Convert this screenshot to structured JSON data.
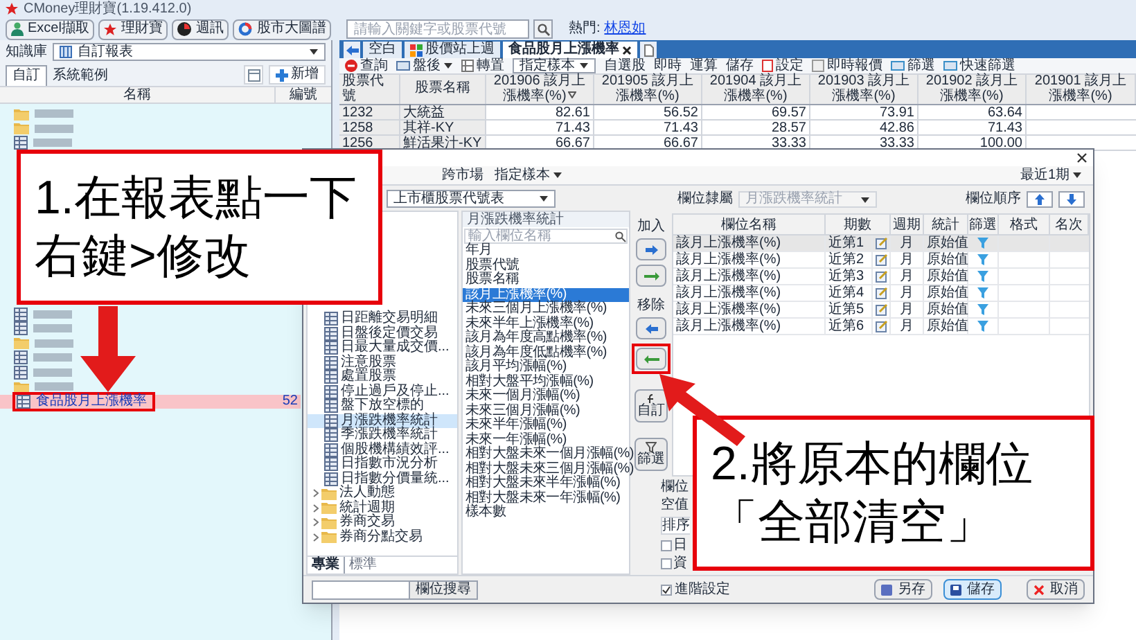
{
  "window": {
    "title": "CMoney理財寶(1.19.412.0)"
  },
  "main_toolbar": {
    "buttons": [
      "Excel擷取",
      "理財寶",
      "週訊",
      "股市大圖譜"
    ],
    "search": {
      "placeholder": "請輸入關鍵字或股票代號"
    },
    "hot_label": "熱門:",
    "hot_link": "林恩如"
  },
  "sidebar": {
    "library_label": "知識庫",
    "library_value": "自訂報表",
    "tabs": [
      {
        "label": "自訂",
        "selected": true
      },
      {
        "label": "系統範例",
        "selected": false
      }
    ],
    "add_button": "新增",
    "columns": [
      "名稱",
      "編號"
    ],
    "items_top": [
      {
        "kind": "folder",
        "selected": false
      },
      {
        "kind": "folder",
        "selected": false
      },
      {
        "kind": "report",
        "selected": false
      }
    ],
    "items_bottom": [
      {
        "kind": "report",
        "selected": false
      },
      {
        "kind": "report",
        "selected": false
      },
      {
        "kind": "folder",
        "selected": false
      },
      {
        "kind": "report",
        "selected": false
      },
      {
        "kind": "report",
        "selected": false
      },
      {
        "kind": "folder",
        "selected": false
      },
      {
        "kind": "report",
        "label": "食品股月上漲機率",
        "number": "52",
        "selected": true
      }
    ]
  },
  "report_tabs": [
    {
      "label": "空白",
      "selected": false
    },
    {
      "label": "股價站上週",
      "selected": false
    },
    {
      "label": "食品股月上漲機率",
      "selected": true
    }
  ],
  "report_toolbar": [
    {
      "kind": "icon",
      "label": "查詢"
    },
    {
      "kind": "menu",
      "label": "盤後"
    },
    {
      "kind": "icon",
      "label": "轉置"
    },
    {
      "kind": "select",
      "label": "指定樣本"
    },
    {
      "kind": "text",
      "label": "自選股"
    },
    {
      "kind": "text",
      "label": "即時"
    },
    {
      "kind": "text",
      "label": "運算"
    },
    {
      "kind": "text",
      "label": "儲存"
    },
    {
      "kind": "icon",
      "label": "設定"
    },
    {
      "kind": "icon",
      "label": "即時報價"
    },
    {
      "kind": "icon",
      "label": "篩選"
    },
    {
      "kind": "icon",
      "label": "快速篩選"
    }
  ],
  "table": {
    "columns": [
      {
        "label": "股票代號",
        "sorted": false
      },
      {
        "label": "股票名稱",
        "sorted": false
      },
      {
        "label": "201906 該月上漲機率(%)",
        "sorted": true
      },
      {
        "label": "201905 該月上漲機率(%)",
        "sorted": false
      },
      {
        "label": "201904 該月上漲機率(%)",
        "sorted": false
      },
      {
        "label": "201903 該月上漲機率(%)",
        "sorted": false
      },
      {
        "label": "201902 該月上漲機率(%)",
        "sorted": false
      },
      {
        "label": "201901 該月上漲機率(%)",
        "sorted": false
      }
    ],
    "rows": [
      [
        "1232",
        "大統益",
        "82.61",
        "56.52",
        "69.57",
        "73.91",
        "63.64"
      ],
      [
        "1258",
        "其祥-KY",
        "71.43",
        "71.43",
        "28.57",
        "42.86",
        "71.43"
      ],
      [
        "1256",
        "鮮活果汁-KY",
        "66.67",
        "66.67",
        "33.33",
        "33.33",
        "100.00"
      ]
    ]
  },
  "dialog": {
    "toolbar": [
      {
        "kind": "text",
        "label": "跨市場"
      },
      {
        "kind": "menu",
        "label": "指定樣本"
      }
    ],
    "period": "最近1期",
    "source": "上市櫃股票代號表",
    "tree": [
      {
        "kind": "table",
        "label": "日距離交易明細",
        "selected": false
      },
      {
        "kind": "table",
        "label": "日盤後定價交易",
        "selected": false
      },
      {
        "kind": "table",
        "label": "日最大量成交價...",
        "selected": false
      },
      {
        "kind": "table",
        "label": "注意股票",
        "selected": false
      },
      {
        "kind": "table",
        "label": "處置股票",
        "selected": false
      },
      {
        "kind": "table",
        "label": "停止過戶及停止...",
        "selected": false
      },
      {
        "kind": "table",
        "label": "盤下放空標的",
        "selected": false
      },
      {
        "kind": "table",
        "label": "月漲跌機率統計",
        "selected": true
      },
      {
        "kind": "table",
        "label": "季漲跌機率統計",
        "selected": false
      },
      {
        "kind": "table",
        "label": "個股機構績效評...",
        "selected": false
      },
      {
        "kind": "table",
        "label": "日指數市況分析",
        "selected": false
      },
      {
        "kind": "table",
        "label": "日指數分價量統...",
        "selected": false
      },
      {
        "kind": "folder",
        "label": "法人動態",
        "selected": false
      },
      {
        "kind": "folder",
        "label": "統計週期",
        "selected": false
      },
      {
        "kind": "folder",
        "label": "券商交易",
        "selected": false
      },
      {
        "kind": "folder",
        "label": "券商分點交易",
        "selected": false
      }
    ],
    "source_tabs": [
      {
        "label": "專業",
        "selected": true
      },
      {
        "label": "標準",
        "selected": false
      }
    ],
    "field_search": "欄位搜尋",
    "list_title": "月漲跌機率統計",
    "list_search": {
      "placeholder": "輸入欄位名稱"
    },
    "fields": [
      {
        "label": "年月",
        "selected": false
      },
      {
        "label": "股票代號",
        "selected": false
      },
      {
        "label": "股票名稱",
        "selected": false
      },
      {
        "label": "該月上漲機率(%)",
        "selected": true
      },
      {
        "label": "未來三個月上漲機率(%)",
        "selected": false
      },
      {
        "label": "未來半年上漲機率(%)",
        "selected": false
      },
      {
        "label": "該月為年度高點機率(%)",
        "selected": false
      },
      {
        "label": "該月為年度低點機率(%)",
        "selected": false
      },
      {
        "label": "該月平均漲幅(%)",
        "selected": false
      },
      {
        "label": "相對大盤平均漲幅(%)",
        "selected": false
      },
      {
        "label": "未來一個月漲幅(%)",
        "selected": false
      },
      {
        "label": "未來三個月漲幅(%)",
        "selected": false
      },
      {
        "label": "未來半年漲幅(%)",
        "selected": false
      },
      {
        "label": "未來一年漲幅(%)",
        "selected": false
      },
      {
        "label": "相對大盤未來一個月漲幅(%)",
        "selected": false
      },
      {
        "label": "相對大盤未來三個月漲幅(%)",
        "selected": false
      },
      {
        "label": "相對大盤未來半年漲幅(%)",
        "selected": false
      },
      {
        "label": "相對大盤未來一年漲幅(%)",
        "selected": false
      },
      {
        "label": "樣本數",
        "selected": false
      }
    ],
    "move_buttons": [
      {
        "kind": "label",
        "label": "加入"
      },
      {
        "kind": "add"
      },
      {
        "kind": "add_all"
      },
      {
        "kind": "label",
        "label": "移除"
      },
      {
        "kind": "remove"
      },
      {
        "kind": "remove_all"
      },
      {
        "kind": "custom",
        "label": "自訂"
      },
      {
        "kind": "filter",
        "label": "篩選"
      }
    ],
    "group_label": "欄位隸屬",
    "group_value": "月漲跌機率統計",
    "order_label": "欄位順序",
    "columns": [
      "欄位名稱",
      "期數",
      "週期",
      "統計",
      "篩選",
      "格式",
      "名次"
    ],
    "rows": [
      {
        "name": "該月上漲機率(%)",
        "period": "近第1",
        "cycle": "月",
        "stat": "原始值",
        "selected": true
      },
      {
        "name": "該月上漲機率(%)",
        "period": "近第2",
        "cycle": "月",
        "stat": "原始值",
        "selected": false
      },
      {
        "name": "該月上漲機率(%)",
        "period": "近第3",
        "cycle": "月",
        "stat": "原始值",
        "selected": false
      },
      {
        "name": "該月上漲機率(%)",
        "period": "近第4",
        "cycle": "月",
        "stat": "原始值",
        "selected": false
      },
      {
        "name": "該月上漲機率(%)",
        "period": "近第5",
        "cycle": "月",
        "stat": "原始值",
        "selected": false
      },
      {
        "name": "該月上漲機率(%)",
        "period": "近第6",
        "cycle": "月",
        "stat": "原始值",
        "selected": false
      }
    ],
    "settings": [
      {
        "kind": "label",
        "label": "欄位"
      },
      {
        "kind": "label",
        "label": "空值"
      },
      {
        "kind": "select",
        "label": "排序"
      }
    ],
    "checkboxes": [
      {
        "label": "日",
        "checked": false
      },
      {
        "label": "資",
        "checked": false
      }
    ],
    "advanced": {
      "label": "進階設定",
      "checked": true
    },
    "buttons": [
      {
        "kind": "save_as",
        "label": "另存"
      },
      {
        "kind": "save",
        "label": "儲存"
      },
      {
        "kind": "cancel",
        "label": "取消"
      }
    ]
  },
  "annotations": [
    {
      "lines": [
        "1.在報表點一下",
        "右鍵>修改"
      ]
    },
    {
      "lines": [
        "2.將原本的欄位",
        "「全部清空」"
      ]
    }
  ]
}
